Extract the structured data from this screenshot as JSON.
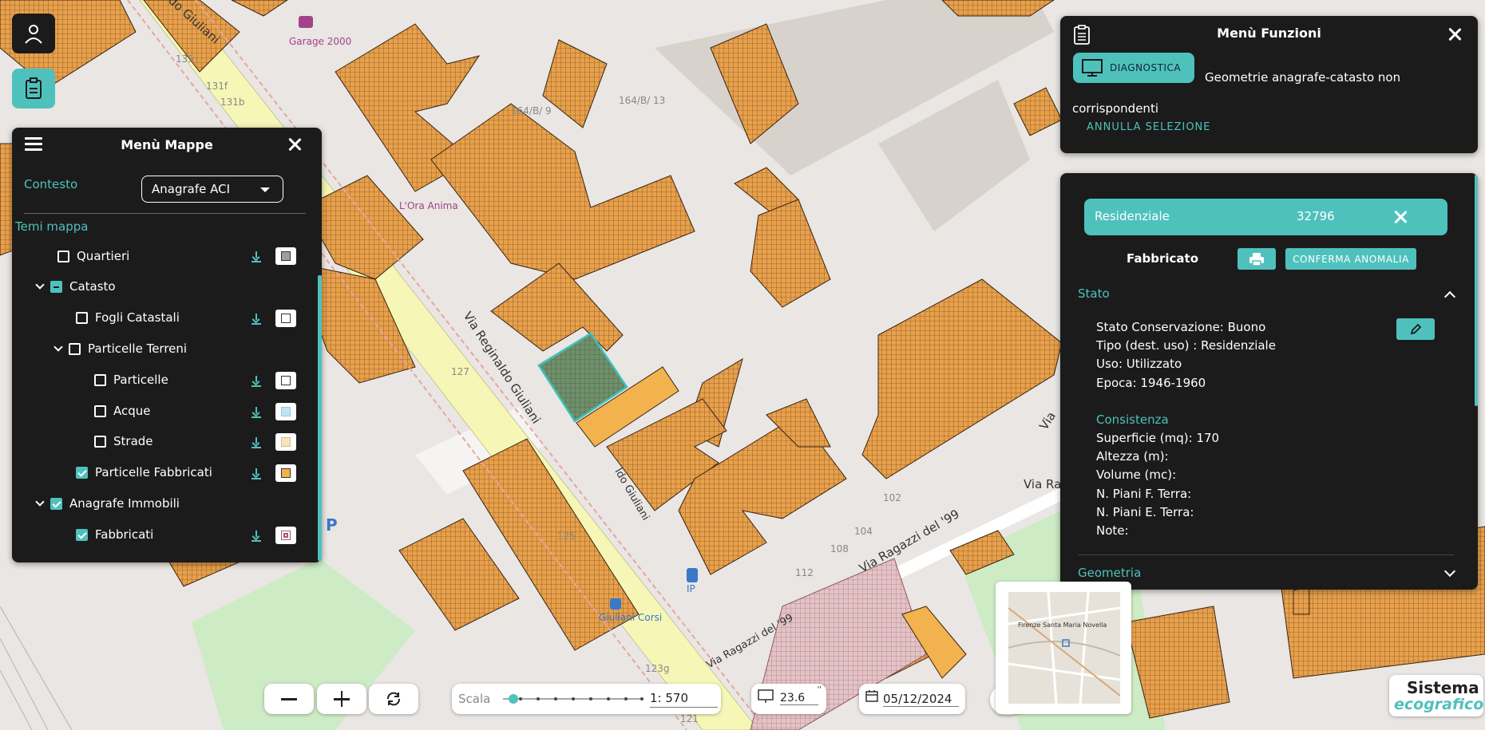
{
  "user": {
    "icon": "user-icon"
  },
  "clipboard": {
    "icon": "clipboard-icon"
  },
  "map_labels": {
    "street_main": "Via Reginaldo Giuliani",
    "street_main_top": "do Giuliani",
    "street_second": "Via Ragazzi del '99",
    "street_second_b": "Via Ragazzi del '99",
    "street_partial_a": "Via Ra",
    "street_partial_b": "Via",
    "street_small": "ldo Giuliani",
    "garage": "Garage 2000",
    "ora": "L'Ora Anima",
    "bus": "Giuliani Corsi",
    "fuel": "IP",
    "num_135": "135",
    "num_131f": "131f",
    "num_131b": "131b",
    "num_164b9": "164/B/ 9",
    "num_164b13": "164/B/ 13",
    "num_127": "127",
    "num_125": "125",
    "num_123g": "123g",
    "num_121": "121",
    "num_102": "102",
    "num_104": "104",
    "num_108": "108",
    "num_112": "112",
    "parking": "P"
  },
  "menu_mappe": {
    "title": "Menù Mappe",
    "context_label": "Contesto",
    "context_value": "Anagrafe ACI",
    "themes_label": "Temi mappa",
    "layers": [
      {
        "label": "Quartieri",
        "state": "unchecked",
        "swatch": "#9e9e9e"
      },
      {
        "label": "Catasto",
        "state": "partial"
      },
      {
        "label": "Fogli Catastali",
        "state": "unchecked",
        "swatch": "#ffffff"
      },
      {
        "label": "Particelle Terreni",
        "state": "unchecked"
      },
      {
        "label": "Particelle",
        "state": "unchecked",
        "swatch": "#ffffff"
      },
      {
        "label": "Acque",
        "state": "unchecked",
        "swatch": "#bfe3f7"
      },
      {
        "label": "Strade",
        "state": "unchecked",
        "swatch": "#fbe3b5"
      },
      {
        "label": "Particelle Fabbricati",
        "state": "checked",
        "swatch": "#f4b14a"
      },
      {
        "label": "Anagrafe Immobili",
        "state": "checked"
      },
      {
        "label": "Fabbricati",
        "state": "checked",
        "swatch": "#a55a6a"
      }
    ]
  },
  "menu_funzioni": {
    "title": "Menù Funzioni",
    "diag_label": "DIAGNOSTICA",
    "description": "Geometrie anagrafe-catasto non corrispondenti",
    "annulla": "ANNULLA SELEZIONE"
  },
  "details": {
    "category": "Residenziale",
    "id": "32796",
    "title": "Fabbricato",
    "confirm": "CONFERMA ANOMALIA",
    "stato_header": "Stato",
    "stato_lines": [
      "Stato Conservazione: Buono",
      "Tipo (dest. uso) : Residenziale",
      "Uso: Utilizzato",
      "Epoca: 1946-1960"
    ],
    "consistenza_header": "Consistenza",
    "consistenza_lines": [
      "Superficie (mq): 170",
      "Altezza (m):",
      "Volume (mc):",
      "N. Piani F. Terra:",
      "N. Piani E. Terra:",
      "Note:"
    ],
    "geometria_header": "Geometria"
  },
  "bottom": {
    "scale_label": "Scala",
    "scale_value": "1: 570",
    "zoom_value": "23.6",
    "date_value": "05/12/2024",
    "zoom_units": "''"
  },
  "minimap": {
    "label": "Firenze Santa Maria Novella"
  },
  "logo": {
    "line1": "Sistema",
    "line2": "ecografico"
  },
  "colors": {
    "accent": "#4fc1bd",
    "panel": "#1b1b1b",
    "building": "#e8a04a",
    "selected": "#6f8f6a"
  }
}
